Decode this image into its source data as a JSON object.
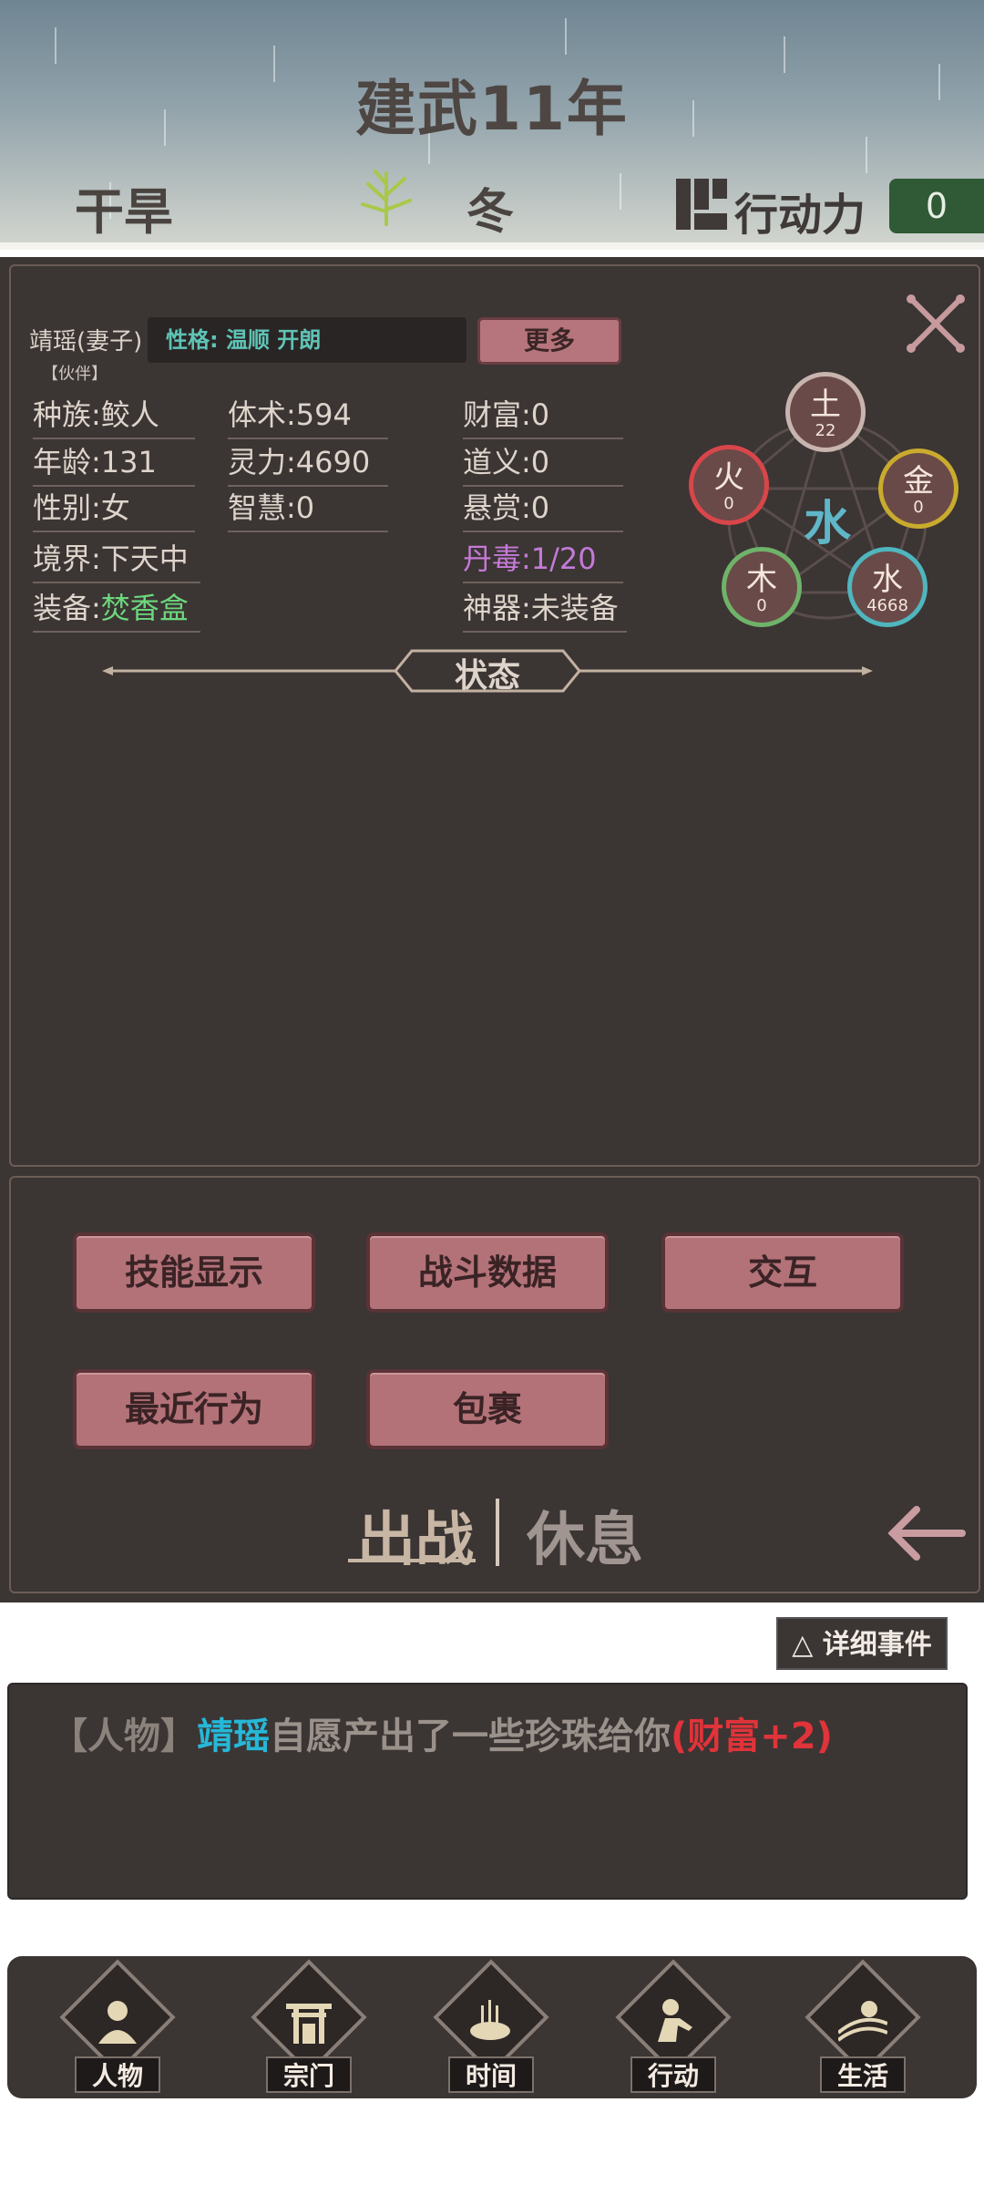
{
  "header": {
    "year_title": "建武11年",
    "weather": "干旱",
    "season": "冬",
    "action_power_label": "行动力",
    "action_power_value": "0",
    "icons": [
      "plant-icon",
      "calendar-icon"
    ]
  },
  "character": {
    "name": "靖瑶(妻子)",
    "role_tag": "【伙伴】",
    "personality": "性格: 温顺  开朗",
    "more_button": "更多",
    "stats": {
      "race": "种族:鲛人",
      "age": "年龄:131",
      "gender": "性别:女",
      "realm": "境界:下天中",
      "equipment_label": "装备:",
      "equipment_value": "焚香盒",
      "physique": "体术:594",
      "spirit": "灵力:4690",
      "wisdom": "智慧:0",
      "wealth": "财富:0",
      "righteousness": "道义:0",
      "bounty": "悬赏:0",
      "pill_toxicity": "丹毒:1/20",
      "artifact": "神器:未装备"
    },
    "five_elements": {
      "main": "水",
      "items": [
        {
          "name": "土",
          "value": "22",
          "color": "#c8b4ae"
        },
        {
          "name": "火",
          "value": "0",
          "color": "#d8464a"
        },
        {
          "name": "金",
          "value": "0",
          "color": "#c9ab2d"
        },
        {
          "name": "木",
          "value": "0",
          "color": "#6fb36a"
        },
        {
          "name": "水",
          "value": "4668",
          "color": "#4fb6be"
        }
      ]
    },
    "status_title": "状态"
  },
  "actions": {
    "skills": "技能显示",
    "battle_data": "战斗数据",
    "interact": "交互",
    "recent": "最近行为",
    "bag": "包裹",
    "deploy": "出战",
    "rest": "休息"
  },
  "events": {
    "detail_button": "△ 详细事件",
    "log": {
      "tag": "【人物】",
      "name": "靖瑶",
      "body": "自愿产出了一些珍珠给你",
      "reward": "(财富+2)"
    }
  },
  "nav": {
    "items": [
      {
        "label": "人物",
        "icon": "person-icon"
      },
      {
        "label": "宗门",
        "icon": "gate-icon"
      },
      {
        "label": "时间",
        "icon": "incense-icon"
      },
      {
        "label": "行动",
        "icon": "action-icon"
      },
      {
        "label": "生活",
        "icon": "field-icon"
      }
    ]
  },
  "colors": {
    "panel_bg": "#3b3534",
    "button_pink": "#b37278",
    "accent_green": "#6cd77d",
    "accent_purple": "#c57ad8",
    "event_name_blue": "#26b8d8",
    "event_reward_red": "#e0333a"
  }
}
